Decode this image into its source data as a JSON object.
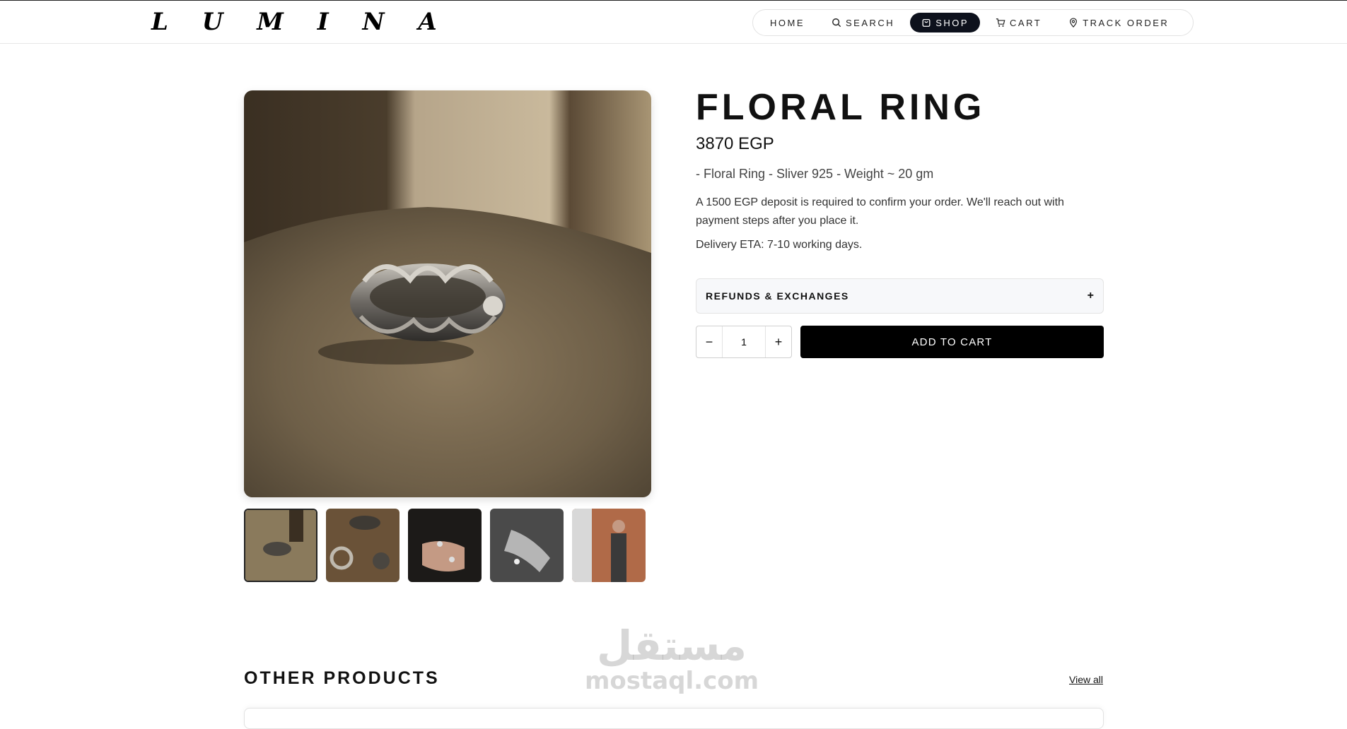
{
  "header": {
    "logo": "L U M I N A",
    "nav": [
      {
        "label": "HOME",
        "icon": null,
        "active": false
      },
      {
        "label": "SEARCH",
        "icon": "search-icon",
        "active": false
      },
      {
        "label": "SHOP",
        "icon": "shopping-bag-icon",
        "active": true
      },
      {
        "label": "CART",
        "icon": "cart-icon",
        "active": false
      },
      {
        "label": "TRACK ORDER",
        "icon": "location-pin-icon",
        "active": false
      }
    ]
  },
  "product": {
    "title": "FLORAL RING",
    "price": "3870 EGP",
    "description": "- Floral Ring - Sliver 925 - Weight ~ 20 gm",
    "deposit_note": "A 1500 EGP deposit is required to confirm your order. We'll reach out with payment steps after you place it.",
    "delivery_eta": "Delivery ETA: 7-10 working days.",
    "accordion": {
      "label": "REFUNDS & EXCHANGES",
      "icon": "+"
    },
    "quantity": {
      "value": "1",
      "minus": "−",
      "plus": "+"
    },
    "add_to_cart": "ADD TO CART",
    "thumbnail_count": 5,
    "selected_thumbnail": 1
  },
  "other_products": {
    "title": "OTHER PRODUCTS",
    "view_all": "View all"
  },
  "watermark": {
    "arabic": "مستقل",
    "latin": "mostaql.com"
  },
  "colors": {
    "accent": "#0d111c",
    "button": "#000000",
    "accordion_bg": "#f7f8fa"
  }
}
